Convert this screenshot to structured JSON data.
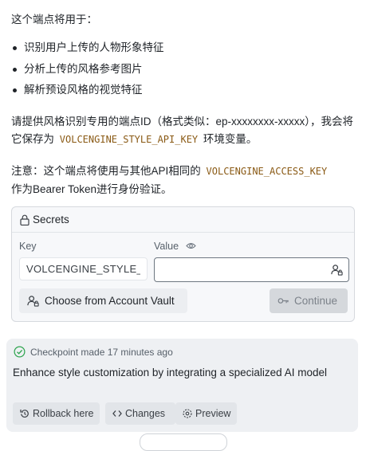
{
  "intro": "这个端点将用于：",
  "bullets": [
    "识别用户上传的人物形象特征",
    "分析上传的风格参考图片",
    "解析预设风格的视觉特征"
  ],
  "para1": {
    "text_a": "请提供风格识别专用的端点ID（格式类似：ep-xxxxxxxx-xxxxx），我会将它保存为",
    "code": "VOLCENGINE_STYLE_API_KEY",
    "text_b": "环境变量。"
  },
  "para2": {
    "text_a": "注意：这个端点将使用与其他API相同的",
    "code": "VOLCENGINE_ACCESS_KEY",
    "text_b": "作为Bearer Token进行身份验证。"
  },
  "secrets": {
    "title": "Secrets",
    "key_label": "Key",
    "value_label": "Value",
    "key_value": "VOLCENGINE_STYLE_API_KEY",
    "value_value": "",
    "vault_button": "Choose from Account Vault",
    "continue_button": "Continue",
    "icons": [
      "lock-icon",
      "eye-icon",
      "vault-person-icon",
      "key-icon"
    ]
  },
  "checkpoint": {
    "title": "Checkpoint made 17 minutes ago",
    "message": "Enhance style customization by integrating a specialized AI model",
    "buttons": {
      "rollback": "Rollback here",
      "changes": "Changes",
      "preview": "Preview"
    },
    "icons": [
      "check-circle-icon",
      "rollback-icon",
      "code-icon",
      "preview-icon"
    ]
  },
  "colors": {
    "code": "#8a5a15",
    "panel_bg": "#f7f8fa",
    "checkpoint_bg": "#eef0f3",
    "check": "#2da44e"
  }
}
